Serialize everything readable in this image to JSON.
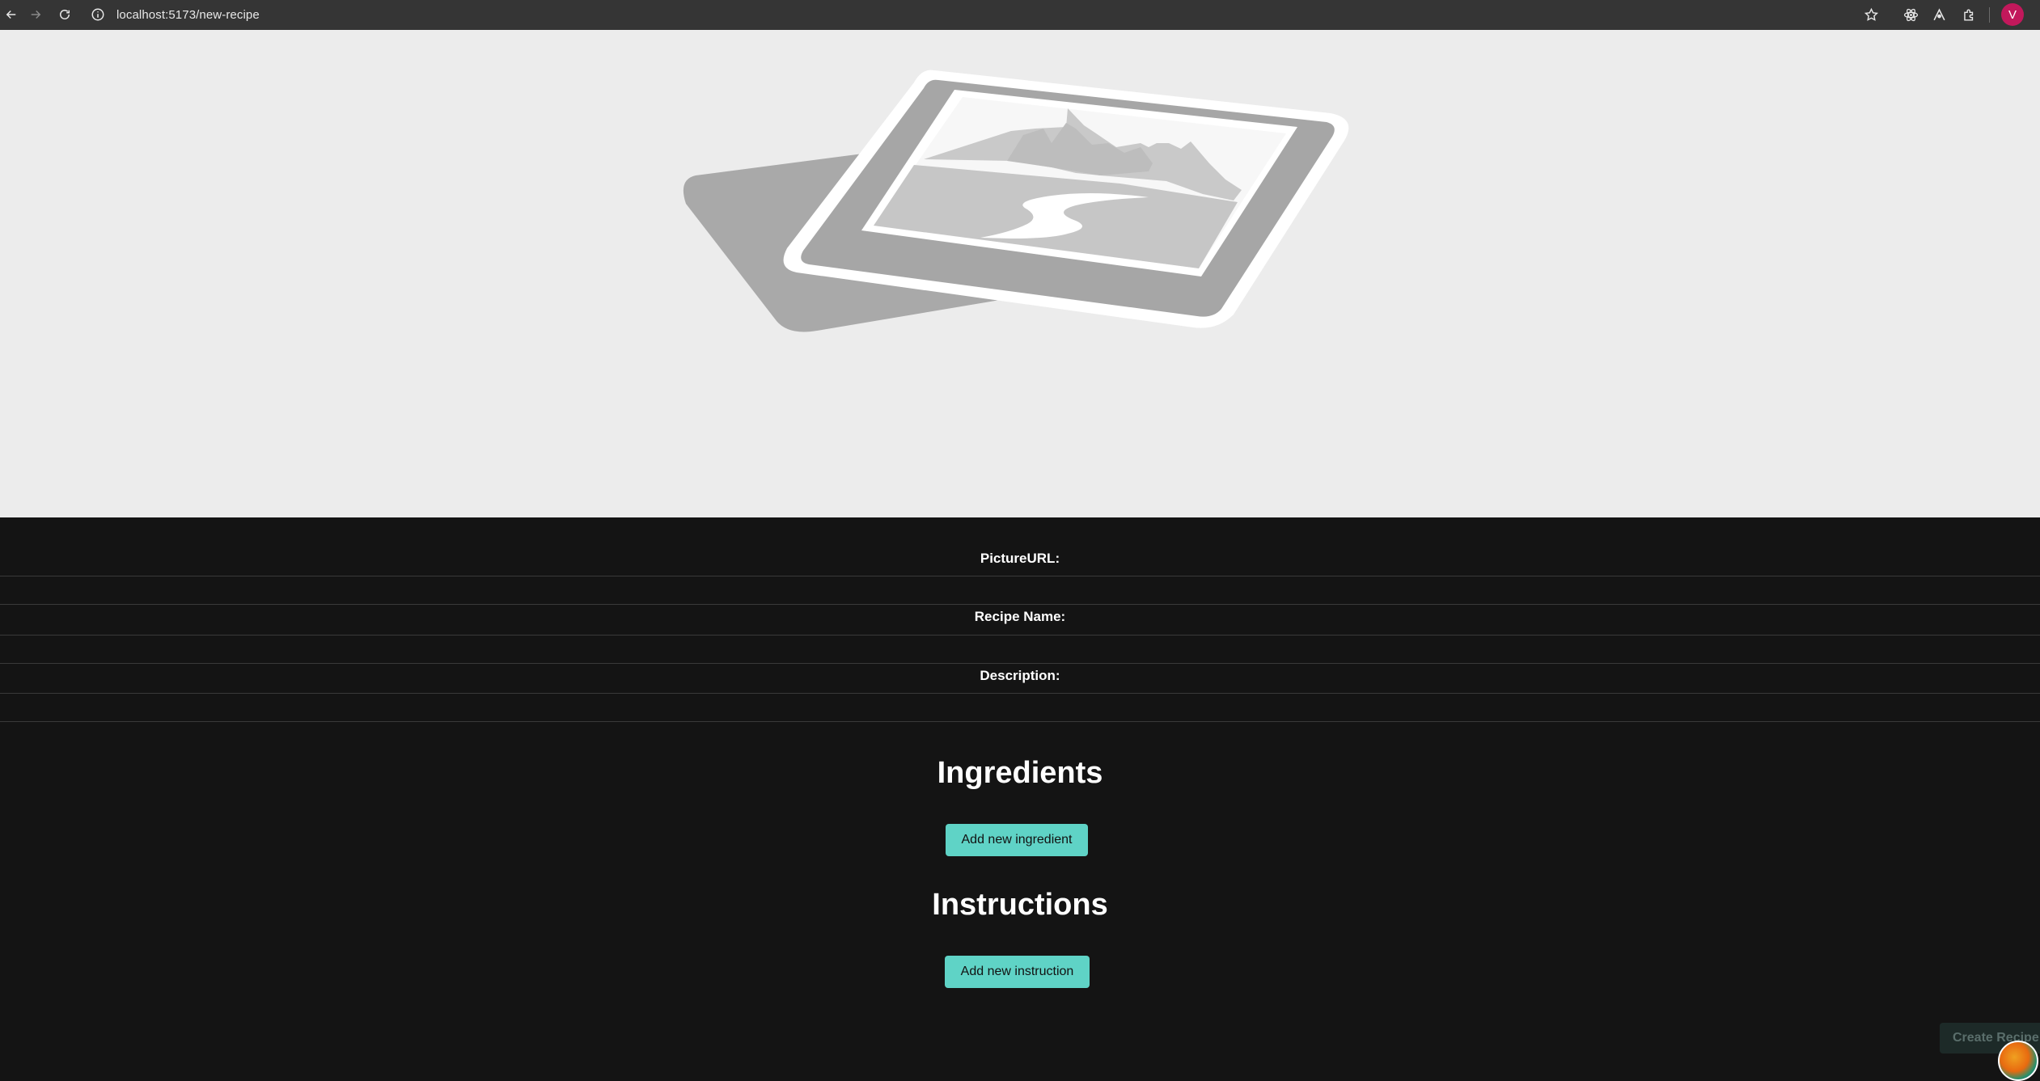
{
  "browser": {
    "url": "localhost:5173/new-recipe",
    "profile_initial": "V",
    "icons": {
      "back": "arrow-left-icon",
      "forward": "arrow-right-icon",
      "reload": "reload-icon",
      "site_info": "info-icon",
      "bookmark": "star-icon",
      "extension_1": "react-devtools-icon",
      "extension_2": "extension-icon",
      "extensions_menu": "puzzle-icon"
    }
  },
  "hero": {
    "image_state": "placeholder"
  },
  "form": {
    "fields": [
      {
        "label": "PictureURL:",
        "value": ""
      },
      {
        "label": "Recipe Name:",
        "value": ""
      },
      {
        "label": "Description:",
        "value": ""
      }
    ]
  },
  "ingredients": {
    "heading": "Ingredients",
    "add_label": "Add new ingredient"
  },
  "instructions": {
    "heading": "Instructions",
    "add_label": "Add new instruction"
  },
  "actions": {
    "create_label": "Create Recipe"
  },
  "colors": {
    "page_background": "#141414",
    "accent_button": "#5fd3c6",
    "chrome_bar": "#353535",
    "hero_background": "#ececec",
    "avatar": "#c2185b"
  }
}
